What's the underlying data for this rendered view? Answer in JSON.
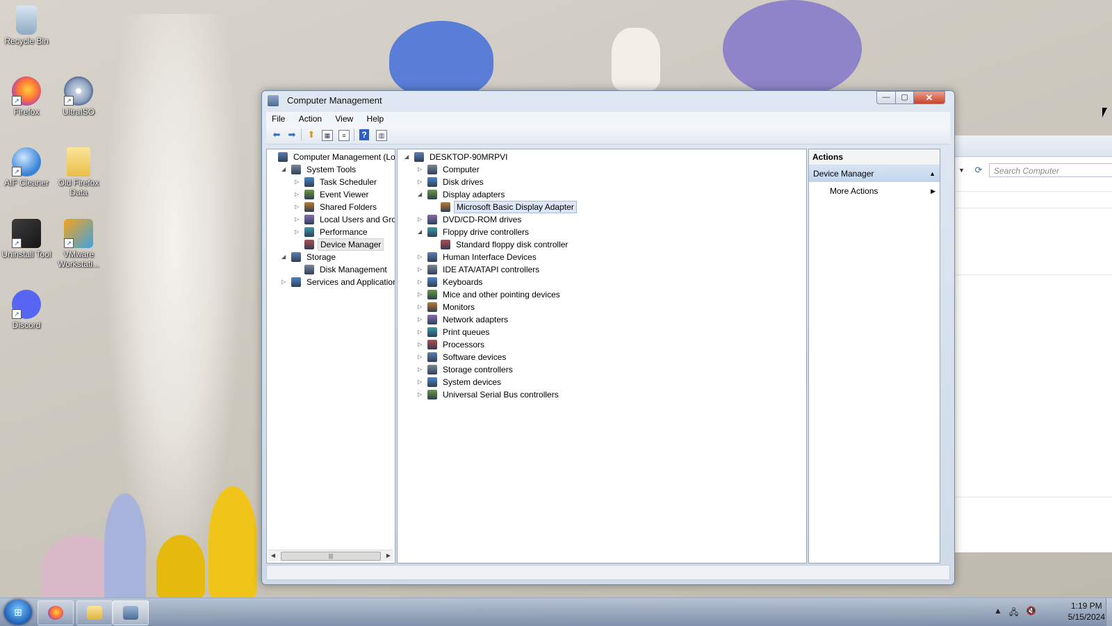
{
  "desktop": {
    "icons": [
      {
        "label": "Recycle Bin"
      },
      {
        "label": "Firefox"
      },
      {
        "label": "UltraISO"
      },
      {
        "label": "AIF Cleaner"
      },
      {
        "label": "Old Firefox Data"
      },
      {
        "label": "Uninstall Tool"
      },
      {
        "label": "VMware Workstati..."
      },
      {
        "label": "Discord"
      }
    ],
    "background_window": {
      "search_placeholder": "Search Computer"
    }
  },
  "window": {
    "title": "Computer Management",
    "menu": [
      "File",
      "Action",
      "View",
      "Help"
    ],
    "left_tree": [
      {
        "label": "Computer Management (Local",
        "level": 0,
        "toggle": ""
      },
      {
        "label": "System Tools",
        "level": 1,
        "toggle": "◢"
      },
      {
        "label": "Task Scheduler",
        "level": 2,
        "toggle": "▷"
      },
      {
        "label": "Event Viewer",
        "level": 2,
        "toggle": "▷"
      },
      {
        "label": "Shared Folders",
        "level": 2,
        "toggle": "▷"
      },
      {
        "label": "Local Users and Groups",
        "level": 2,
        "toggle": "▷"
      },
      {
        "label": "Performance",
        "level": 2,
        "toggle": "▷"
      },
      {
        "label": "Device Manager",
        "level": 2,
        "toggle": ""
      },
      {
        "label": "Storage",
        "level": 1,
        "toggle": "◢"
      },
      {
        "label": "Disk Management",
        "level": 2,
        "toggle": ""
      },
      {
        "label": "Services and Applications",
        "level": 1,
        "toggle": "▷"
      }
    ],
    "device_tree": [
      {
        "label": "DESKTOP-90MRPVI",
        "level": 0,
        "toggle": "◢"
      },
      {
        "label": "Computer",
        "level": 1,
        "toggle": "▷"
      },
      {
        "label": "Disk drives",
        "level": 1,
        "toggle": "▷"
      },
      {
        "label": "Display adapters",
        "level": 1,
        "toggle": "◢"
      },
      {
        "label": "Microsoft Basic Display Adapter",
        "level": 2,
        "toggle": ""
      },
      {
        "label": "DVD/CD-ROM drives",
        "level": 1,
        "toggle": "▷"
      },
      {
        "label": "Floppy drive controllers",
        "level": 1,
        "toggle": "◢"
      },
      {
        "label": "Standard floppy disk controller",
        "level": 2,
        "toggle": ""
      },
      {
        "label": "Human Interface Devices",
        "level": 1,
        "toggle": "▷"
      },
      {
        "label": "IDE ATA/ATAPI controllers",
        "level": 1,
        "toggle": "▷"
      },
      {
        "label": "Keyboards",
        "level": 1,
        "toggle": "▷"
      },
      {
        "label": "Mice and other pointing devices",
        "level": 1,
        "toggle": "▷"
      },
      {
        "label": "Monitors",
        "level": 1,
        "toggle": "▷"
      },
      {
        "label": "Network adapters",
        "level": 1,
        "toggle": "▷"
      },
      {
        "label": "Print queues",
        "level": 1,
        "toggle": "▷"
      },
      {
        "label": "Processors",
        "level": 1,
        "toggle": "▷"
      },
      {
        "label": "Software devices",
        "level": 1,
        "toggle": "▷"
      },
      {
        "label": "Storage controllers",
        "level": 1,
        "toggle": "▷"
      },
      {
        "label": "System devices",
        "level": 1,
        "toggle": "▷"
      },
      {
        "label": "Universal Serial Bus controllers",
        "level": 1,
        "toggle": "▷"
      }
    ],
    "actions": {
      "title": "Actions",
      "section": "Device Manager",
      "more": "More Actions"
    }
  },
  "taskbar": {
    "time": "1:19 PM",
    "date": "5/15/2024"
  },
  "colors": {
    "selection": "#dce8f7",
    "actions_header": "#c2d5ec",
    "close_button": "#c7432a"
  }
}
